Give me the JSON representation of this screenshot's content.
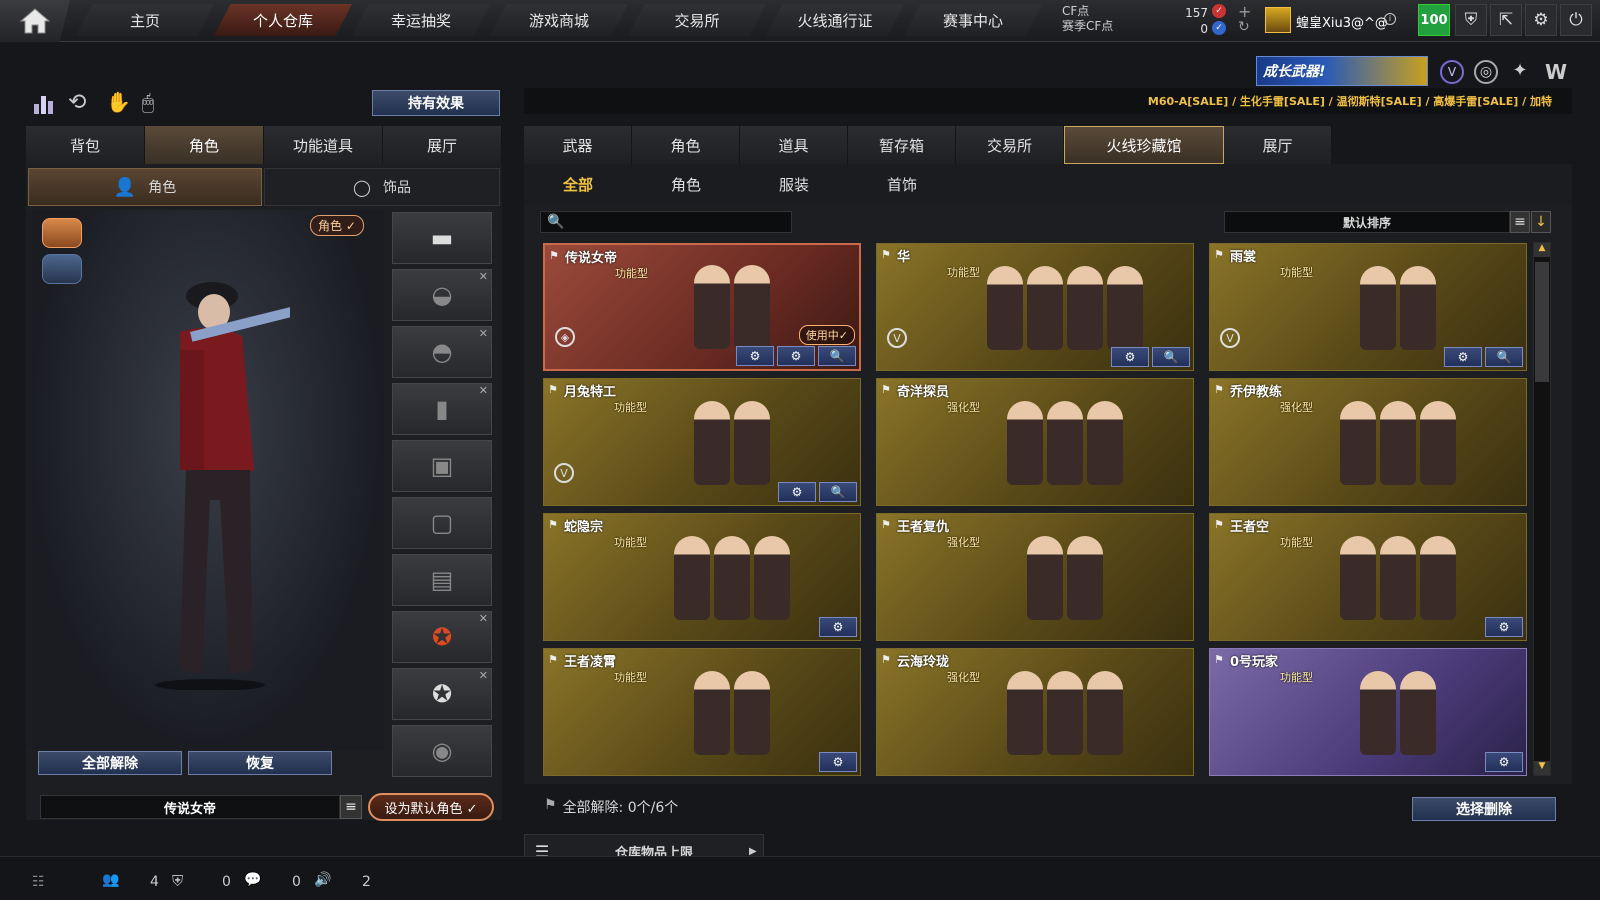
{
  "nav": {
    "tabs": [
      "主页",
      "个人仓库",
      "幸运抽奖",
      "游戏商城",
      "交易所",
      "火线通行证",
      "赛事中心"
    ],
    "active": "个人仓库"
  },
  "currency": {
    "cf_label": "CF点",
    "season_label": "赛季CF点",
    "cf_value": "157",
    "season_value": "0"
  },
  "user": {
    "name": "蝗皇Xiu3@^@",
    "level": "100"
  },
  "banner": {
    "text": "成长武器!"
  },
  "ticker": "M60-A[SALE] / 生化手雷[SALE] / 温彻斯特[SALE] / 高爆手雷[SALE] / 加特",
  "left": {
    "effects_button": "持有效果",
    "tabs": [
      "背包",
      "角色",
      "功能道具",
      "展厅"
    ],
    "active_tab": "角色",
    "subtabs": [
      "角色",
      "饰品"
    ],
    "role_badge": "角色 ✓",
    "unequip_all": "全部解除",
    "restore": "恢复",
    "current_role": "传说女帝",
    "set_default": "设为默认角色 ✓"
  },
  "right": {
    "tabs": [
      "武器",
      "角色",
      "道具",
      "暂存箱",
      "交易所",
      "火线珍藏馆",
      "展厅"
    ],
    "active_tab": "火线珍藏馆",
    "subtabs": [
      "全部",
      "角色",
      "服装",
      "首饰"
    ],
    "active_subtab": "全部",
    "search_placeholder": "",
    "sort_label": "默认排序",
    "footer_label": "全部解除: 0个/6个",
    "select_delete": "选择删除",
    "capacity_label": "仓库物品上限"
  },
  "cards": [
    {
      "name": "传说女帝",
      "type": "功能型",
      "in_use": "使用中✓",
      "figs": 2
    },
    {
      "name": "华",
      "type": "功能型",
      "figs": 4
    },
    {
      "name": "雨裳",
      "type": "功能型",
      "figs": 2
    },
    {
      "name": "月兔特工",
      "type": "功能型",
      "figs": 2
    },
    {
      "name": "奇洋探员",
      "type": "强化型",
      "figs": 3
    },
    {
      "name": "乔伊教练",
      "type": "强化型",
      "figs": 3
    },
    {
      "name": "蛇隐宗",
      "type": "功能型",
      "figs": 3
    },
    {
      "name": "王者复仇",
      "type": "强化型",
      "figs": 2
    },
    {
      "name": "王者空",
      "type": "功能型",
      "figs": 3
    },
    {
      "name": "王者凌霄",
      "type": "功能型",
      "figs": 2
    },
    {
      "name": "云海玲珑",
      "type": "强化型",
      "figs": 3
    },
    {
      "name": "0号玩家",
      "type": "功能型",
      "figs": 2
    }
  ],
  "status": {
    "friends": "4",
    "guild": "0",
    "chat": "0",
    "volume": "2"
  }
}
